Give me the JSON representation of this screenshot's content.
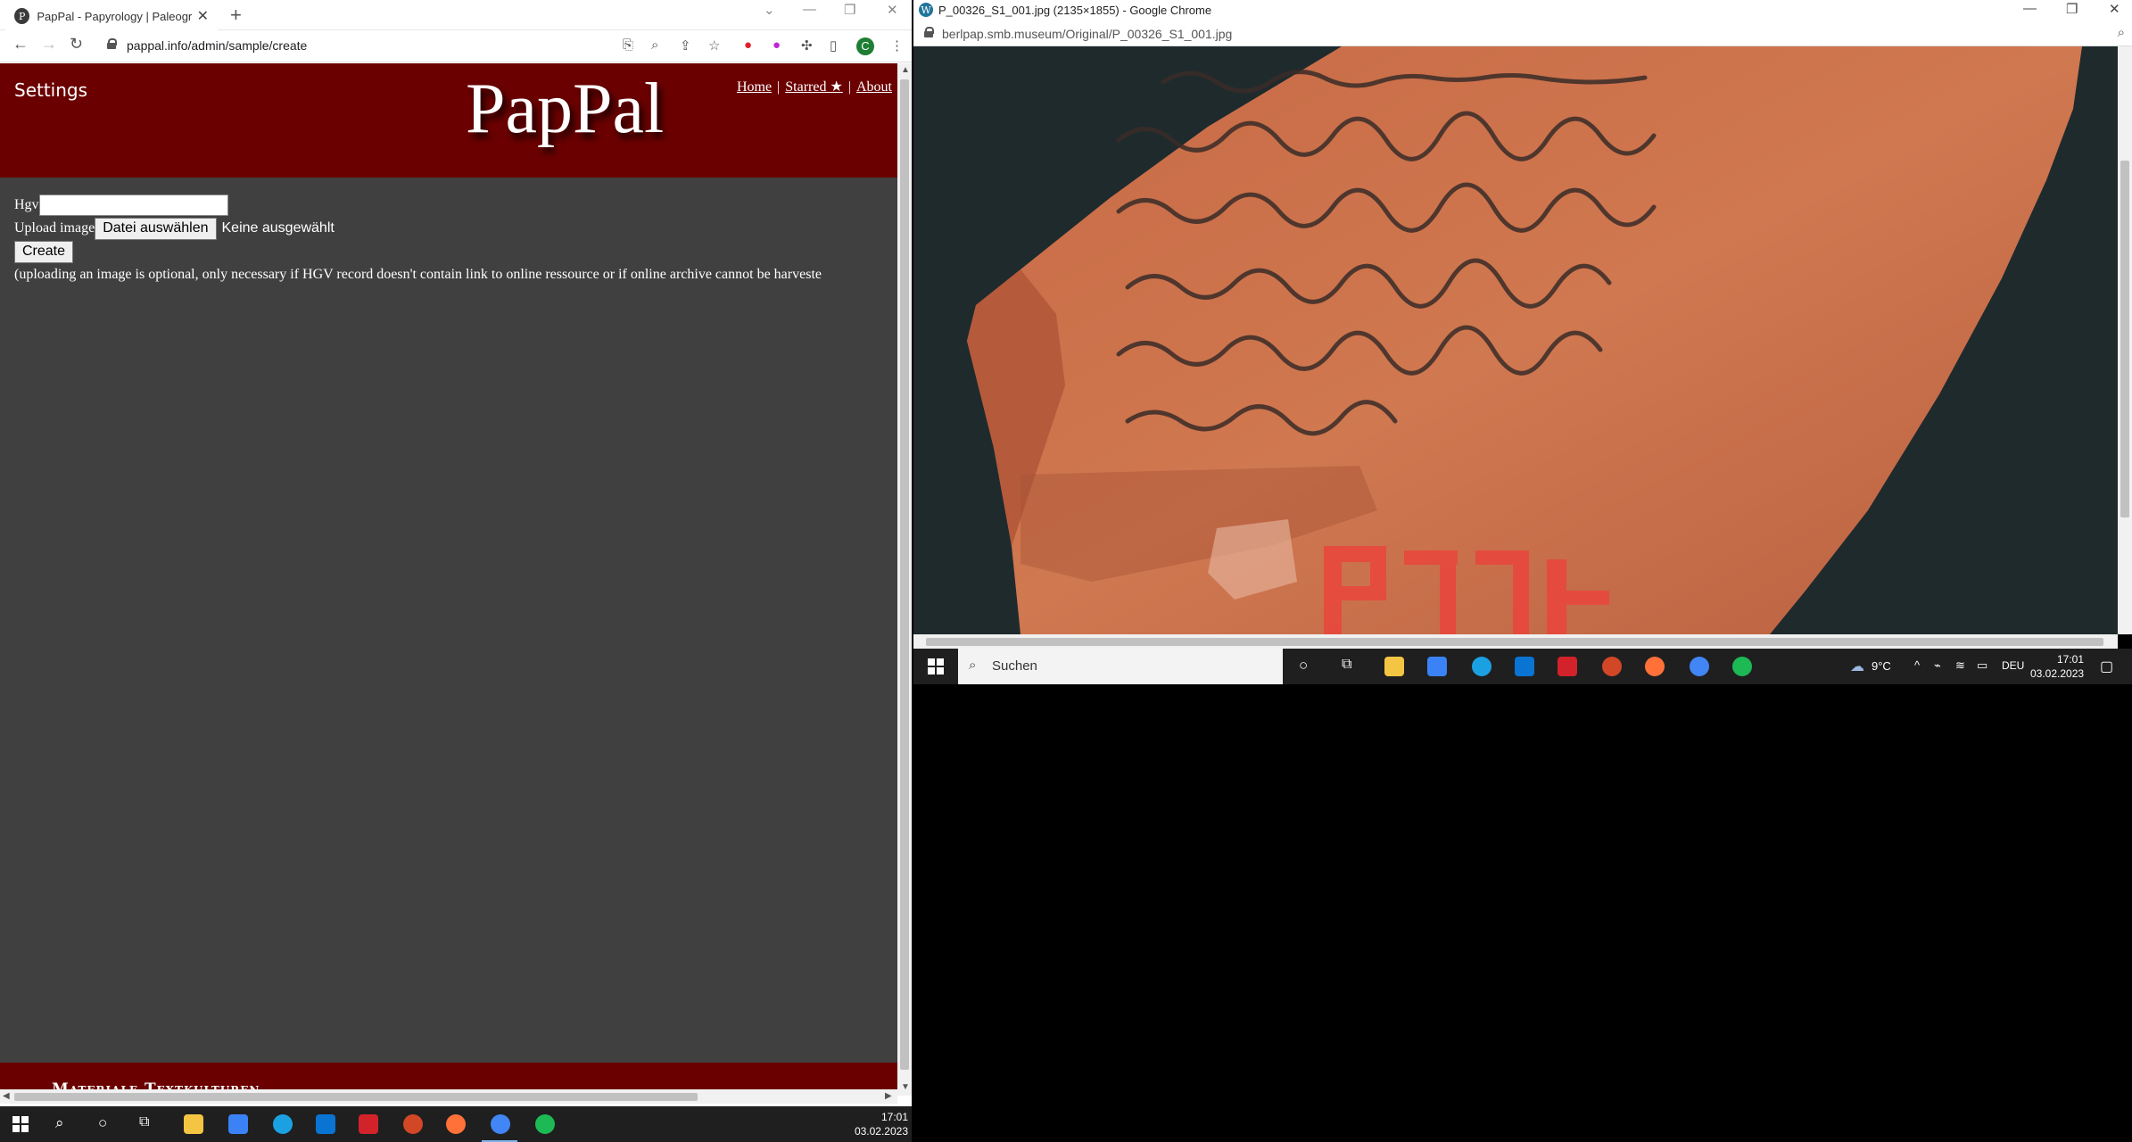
{
  "left_window": {
    "tab_title": "PapPal - Papyrology | Paleography",
    "url": "pappal.info/admin/sample/create"
  },
  "site": {
    "settings_label": "Settings",
    "logo": "PapPal",
    "nav": {
      "home": "Home",
      "starred": "Starred ★",
      "about": "About",
      "sep": "|"
    },
    "form": {
      "hgv_label": "Hgv",
      "hgv_value": "",
      "upload_label": "Upload image",
      "file_button": "Datei auswählen",
      "file_status": "Keine ausgewählt",
      "create_button": "Create",
      "note": "(uploading an image is optional, only necessary if HGV record doesn't contain link to online ressource or if online archive cannot be harveste"
    },
    "footer_title": "Materiale Textkulturen"
  },
  "right_window": {
    "title": "P_00326_S1_001.jpg (2135×1855) - Google Chrome",
    "url": "berlpap.smb.museum/Original/P_00326_S1_001.jpg"
  },
  "taskbar_left": {
    "time": "17:01",
    "date": "03.02.2023"
  },
  "taskbar_right": {
    "search_placeholder": "Suchen",
    "weather": "9°C",
    "language": "DEU",
    "time": "17:01",
    "date": "03.02.2023"
  },
  "colors": {
    "header_red": "#6b0000",
    "page_bg": "#404040",
    "taskbar": "#1f1f1f"
  }
}
